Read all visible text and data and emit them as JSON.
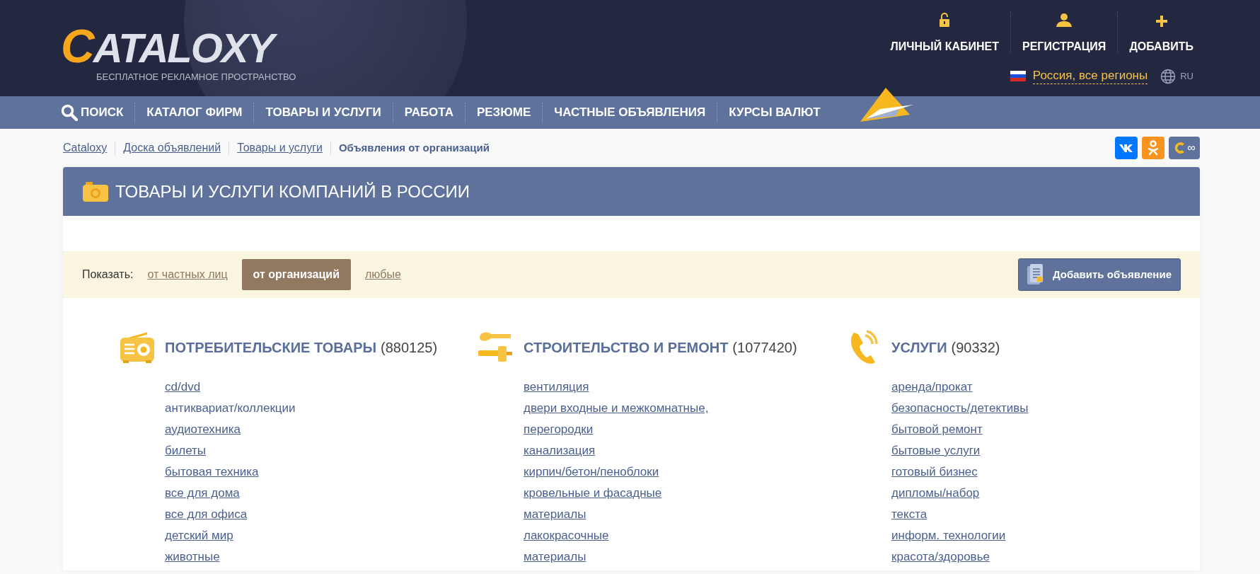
{
  "header": {
    "logo": "CATALOXY",
    "tagline": "БЕСПЛАТНОЕ РЕКЛАМНОЕ ПРОСТРАНСТВО",
    "user_links": [
      {
        "label": "ЛИЧНЫЙ КАБИНЕТ",
        "kind": "lock"
      },
      {
        "label": "РЕГИСТРАЦИЯ",
        "kind": "person"
      },
      {
        "label": "ДОБАВИТЬ",
        "kind": "plus"
      }
    ],
    "region": "Россия, все регионы",
    "language": "RU"
  },
  "nav": {
    "items": [
      {
        "label": "ПОИСК",
        "kind": "search"
      },
      {
        "label": "КАТАЛОГ ФИРМ",
        "kind": "plain"
      },
      {
        "label": "ТОВАРЫ И УСЛУГИ",
        "kind": "plain"
      },
      {
        "label": "РАБОТА",
        "kind": "plain"
      },
      {
        "label": "РЕЗЮМЕ",
        "kind": "plain"
      },
      {
        "label": "ЧАСТНЫЕ ОБЪЯВЛЕНИЯ",
        "kind": "plain"
      },
      {
        "label": "КУРСЫ ВАЛЮТ",
        "kind": "plain"
      }
    ]
  },
  "breadcrumbs": [
    {
      "label": "Cataloxy",
      "current": false
    },
    {
      "label": "Доска объявлений",
      "current": false
    },
    {
      "label": "Товары и услуги",
      "current": false
    },
    {
      "label": "Объявления от организаций",
      "current": true
    }
  ],
  "social": [
    {
      "kind": "vk"
    },
    {
      "kind": "ok"
    },
    {
      "kind": "cataloxy",
      "label": "∞"
    }
  ],
  "page_title": "ТОВАРЫ И УСЛУГИ КОМПАНИЙ В РОССИИ",
  "filter": {
    "label": "Показать:",
    "options": [
      {
        "label": "от частных лиц",
        "selected": false
      },
      {
        "label": "от организаций",
        "selected": true
      },
      {
        "label": "любые",
        "selected": false
      }
    ],
    "add_button": "Добавить объявление"
  },
  "categories": [
    {
      "title": "ПОТРЕБИТЕЛЬСКИЕ ТОВАРЫ",
      "count": "(880125)",
      "kind": "radio",
      "items": [
        {
          "label": "cd/dvd",
          "underlined": true
        },
        {
          "label": "антиквариат/коллекции",
          "underlined": false
        },
        {
          "label": "аудиотехника",
          "underlined": true
        },
        {
          "label": "билеты",
          "underlined": true
        },
        {
          "label": "бытовая техника",
          "underlined": true
        },
        {
          "label": "все для дома",
          "underlined": true
        },
        {
          "label": "все для офиса",
          "underlined": true
        },
        {
          "label": "детский мир",
          "underlined": true
        },
        {
          "label": "животные",
          "underlined": true
        }
      ]
    },
    {
      "title": "СТРОИТЕЛЬСТВО И РЕМОНТ",
      "count": "(1077420)",
      "kind": "tools",
      "items": [
        {
          "label": "вентиляция",
          "underlined": true
        },
        {
          "label": "двери входные и межкомнатные,\nперегородки",
          "underlined": true
        },
        {
          "label": "канализация",
          "underlined": true
        },
        {
          "label": "кирпич/бетон/пеноблоки",
          "underlined": true
        },
        {
          "label": "кровельные и фасадные\nматериалы",
          "underlined": true
        },
        {
          "label": "лакокрасочные\nматериалы",
          "underlined": true
        }
      ]
    },
    {
      "title": "УСЛУГИ",
      "count": "(90332)",
      "kind": "phone",
      "items": [
        {
          "label": "аренда/прокат",
          "underlined": true
        },
        {
          "label": "безопасность/детективы",
          "underlined": true
        },
        {
          "label": "бытовой ремонт",
          "underlined": true
        },
        {
          "label": "бытовые услуги",
          "underlined": true
        },
        {
          "label": "готовый бизнес",
          "underlined": true
        },
        {
          "label": "дипломы/набор\nтекста",
          "underlined": true
        },
        {
          "label": "информ. технологии",
          "underlined": true
        },
        {
          "label": "красота/здоровье",
          "underlined": true
        }
      ]
    }
  ]
}
